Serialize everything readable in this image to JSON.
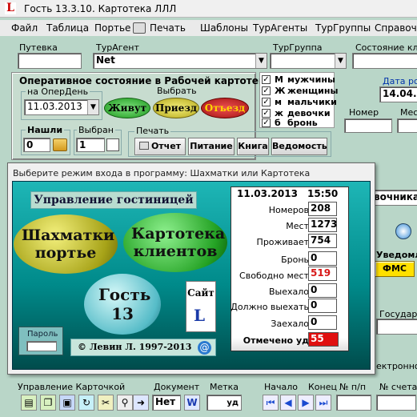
{
  "app": {
    "title": "Гость 13.3.10.  Картотека ЛЛЛ"
  },
  "menu": [
    "Файл",
    "Таблица",
    "Портье",
    "Печать",
    "Шаблоны",
    "ТурАгенты",
    "ТурГруппы",
    "Справочн"
  ],
  "top": {
    "putevka_label": "Путевка",
    "turagent_label": "ТурАгент",
    "turagent_value": "Net",
    "turgroup_label": "ТурГруппа",
    "state_label": "Состояние кли",
    "date_label": "Дата ро",
    "date_value": "14.04.2",
    "nomer_label": "Номер",
    "mes_label": "Мес"
  },
  "oper": {
    "title": "Оперативное состояние в Рабочей картотеке",
    "day_label": "на  ОперДень",
    "day_value": "11.03.2013",
    "select_label": "Выбрать",
    "b1": "Живут",
    "b2": "Приезд",
    "b3": "Отъезд"
  },
  "checks": [
    {
      "code": "М",
      "label": "мужчины"
    },
    {
      "code": "Ж",
      "label": "женщины"
    },
    {
      "code": "м",
      "label": "мальчики"
    },
    {
      "code": "ж",
      "label": "девочки"
    },
    {
      "code": "б",
      "label": " бронь"
    }
  ],
  "found": {
    "label": "Нашли",
    "value": "0"
  },
  "chosen": {
    "label": "Выбран",
    "value": "1"
  },
  "print": {
    "label": "Печать",
    "b1": "Отчет",
    "b2": "Питание",
    "b3": "Книга",
    "b4": "Ведомость"
  },
  "dialog": {
    "title": "Выберите режим входа в программу: Шахматки или Картотека",
    "header": "Управление гостиницей",
    "chess": "Шахматки портье",
    "cards": "Картотека клиентов",
    "guest": "Гость 13",
    "site": "Сайт",
    "password": "Пароль",
    "copyright": "©  Левин Л.  1997-2013",
    "date": "11.03.2013",
    "time": "15:50"
  },
  "stats": [
    {
      "label": "Номеров",
      "value": "208"
    },
    {
      "label": "Мест",
      "value": "1273"
    },
    {
      "label": "Проживает",
      "value": "754"
    },
    {
      "label": "Бронь",
      "value": "0"
    },
    {
      "label": "Свободно мест",
      "value": "519"
    },
    {
      "label": "Выехало",
      "value": "0"
    },
    {
      "label": "Должно выехать",
      "value": "0"
    },
    {
      "label": "Заехало",
      "value": "0"
    },
    {
      "label": "Отмечено уд",
      "value": "55"
    }
  ],
  "right": {
    "partial1": "вочника",
    "uved": "Уведомле",
    "fms": "ФМС",
    "gos": "Государс",
    "elec": "ектронно"
  },
  "bottom": {
    "manage_label": "Управление Карточкой",
    "doc_label": "Документ",
    "doc_value": "Нет",
    "mark_label": "Метка",
    "mark_suffix": "уд",
    "start_label": "Начало",
    "end_label": "Конец",
    "np_label": "№ п/п",
    "acc_label": "№ счета"
  },
  "colors": {
    "bg": "#b9d6c8",
    "dialog_bg": "#008c8c",
    "red": "#d81818"
  }
}
